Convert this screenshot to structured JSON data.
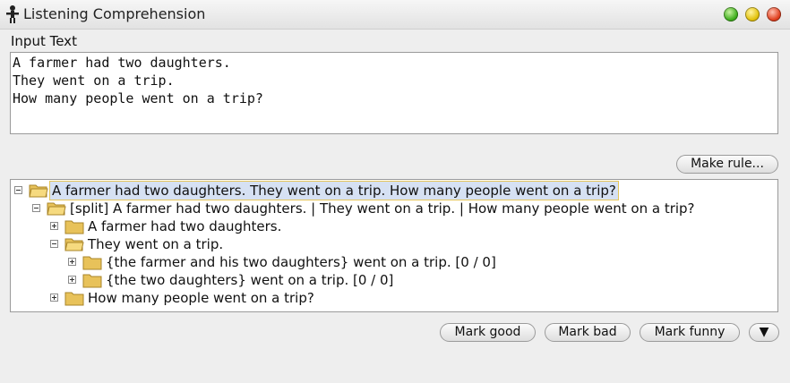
{
  "window": {
    "title": "Listening Comprehension"
  },
  "input": {
    "label": "Input Text",
    "value": "A farmer had two daughters.\nThey went on a trip.\nHow many people went on a trip?"
  },
  "buttons": {
    "make_rule": "Make rule...",
    "mark_good": "Mark good",
    "mark_bad": "Mark bad",
    "mark_funny": "Mark funny",
    "dropdown": "▼"
  },
  "tree": [
    {
      "text": "A farmer had two daughters. They went on a trip. How many people went on a trip?",
      "expanded": true,
      "selected": true
    },
    {
      "text": "[split] A farmer had two daughters. | They went on a trip. | How many people went on a trip?",
      "expanded": true
    },
    {
      "text": "A farmer had two daughters.",
      "expanded": false
    },
    {
      "text": "They went on a trip.",
      "expanded": true
    },
    {
      "text": "{the farmer and his two daughters} went on a trip. [0 / 0]",
      "expanded": false
    },
    {
      "text": "{the two daughters} went on a trip. [0 / 0]",
      "expanded": false
    },
    {
      "text": "How many people went on a trip?",
      "expanded": false
    }
  ],
  "icons": {
    "app": "app-figure-icon",
    "node": "folder-icon"
  }
}
